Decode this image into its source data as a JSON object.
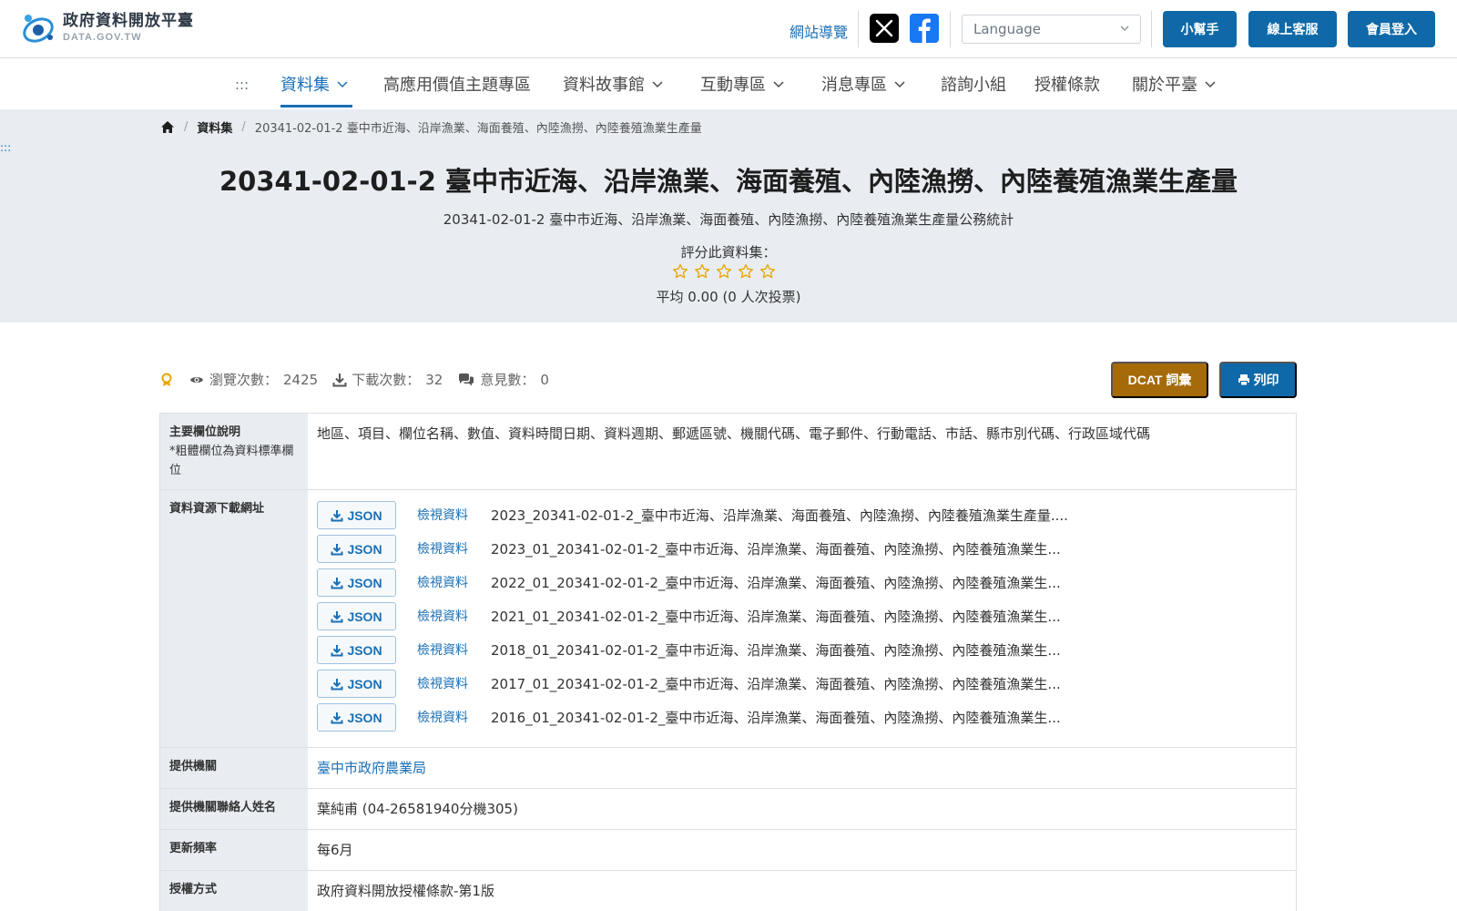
{
  "header": {
    "logo_title": "政府資料開放平臺",
    "logo_sub": "DATA.GOV.TW",
    "site_nav": "網站導覽",
    "language_placeholder": "Language",
    "buttons": {
      "helper": "小幫手",
      "support": "線上客服",
      "login": "會員登入"
    }
  },
  "nav": {
    "anchor": ":::",
    "items": [
      {
        "label": "資料集",
        "dropdown": true,
        "active": true
      },
      {
        "label": "高應用價值主題專區",
        "dropdown": false
      },
      {
        "label": "資料故事館",
        "dropdown": true
      },
      {
        "label": "互動專區",
        "dropdown": true
      },
      {
        "label": "消息專區",
        "dropdown": true
      },
      {
        "label": "諮詢小組",
        "dropdown": false
      },
      {
        "label": "授權條款",
        "dropdown": false
      },
      {
        "label": "關於平臺",
        "dropdown": true
      }
    ]
  },
  "breadcrumb": {
    "section": "資料集",
    "current": "20341-02-01-2 臺中市近海、沿岸漁業、海面養殖、內陸漁撈、內陸養殖漁業生產量"
  },
  "side_anchor": ":::",
  "dataset": {
    "title": "20341-02-01-2 臺中市近海、沿岸漁業、海面養殖、內陸漁撈、內陸養殖漁業生產量",
    "subtitle": "20341-02-01-2 臺中市近海、沿岸漁業、海面養殖、內陸漁撈、內陸養殖漁業生產量公務統計",
    "rate_label": "評分此資料集：",
    "rating": 0,
    "max_rating": 5,
    "average_text": "平均 0.00 (0 人次投票)"
  },
  "stats": {
    "views_label": "瀏覽次數：",
    "views": "2425",
    "downloads_label": "下載次數：",
    "downloads": "32",
    "comments_label": "意見數：",
    "comments": "0"
  },
  "actions": {
    "dcat": "DCAT 詞彙",
    "print": "列印"
  },
  "colors": {
    "primary": "#0f69a8",
    "dcat": "#a56a0a",
    "hero_bg": "#e9edf2",
    "star": "#e8a500"
  },
  "info": {
    "fields_label": "主要欄位說明",
    "fields_note": "*粗體欄位為資料標準欄位",
    "fields_value": "地區、項目、欄位名稱、數值、資料時間日期、資料週期、郵遞區號、機關代碼、電子郵件、行動電話、市話、縣市別代碼、行政區域代碼",
    "resources_label": "資料資源下載網址",
    "resource_format": "JSON",
    "view_label": "檢視資料",
    "resources": [
      "2023_20341-02-01-2_臺中市近海、沿岸漁業、海面養殖、內陸漁撈、內陸養殖漁業生產量....",
      "2023_01_20341-02-01-2_臺中市近海、沿岸漁業、海面養殖、內陸漁撈、內陸養殖漁業生...",
      "2022_01_20341-02-01-2_臺中市近海、沿岸漁業、海面養殖、內陸漁撈、內陸養殖漁業生...",
      "2021_01_20341-02-01-2_臺中市近海、沿岸漁業、海面養殖、內陸漁撈、內陸養殖漁業生...",
      "2018_01_20341-02-01-2_臺中市近海、沿岸漁業、海面養殖、內陸漁撈、內陸養殖漁業生...",
      "2017_01_20341-02-01-2_臺中市近海、沿岸漁業、海面養殖、內陸漁撈、內陸養殖漁業生...",
      "2016_01_20341-02-01-2_臺中市近海、沿岸漁業、海面養殖、內陸漁撈、內陸養殖漁業生..."
    ],
    "provider_label": "提供機關",
    "provider": "臺中市政府農業局",
    "contact_label": "提供機關聯絡人姓名",
    "contact": "葉純甫 (04-26581940分機305)",
    "frequency_label": "更新頻率",
    "frequency": "每6月",
    "license_label": "授權方式",
    "license": "政府資料開放授權條款-第1版"
  }
}
